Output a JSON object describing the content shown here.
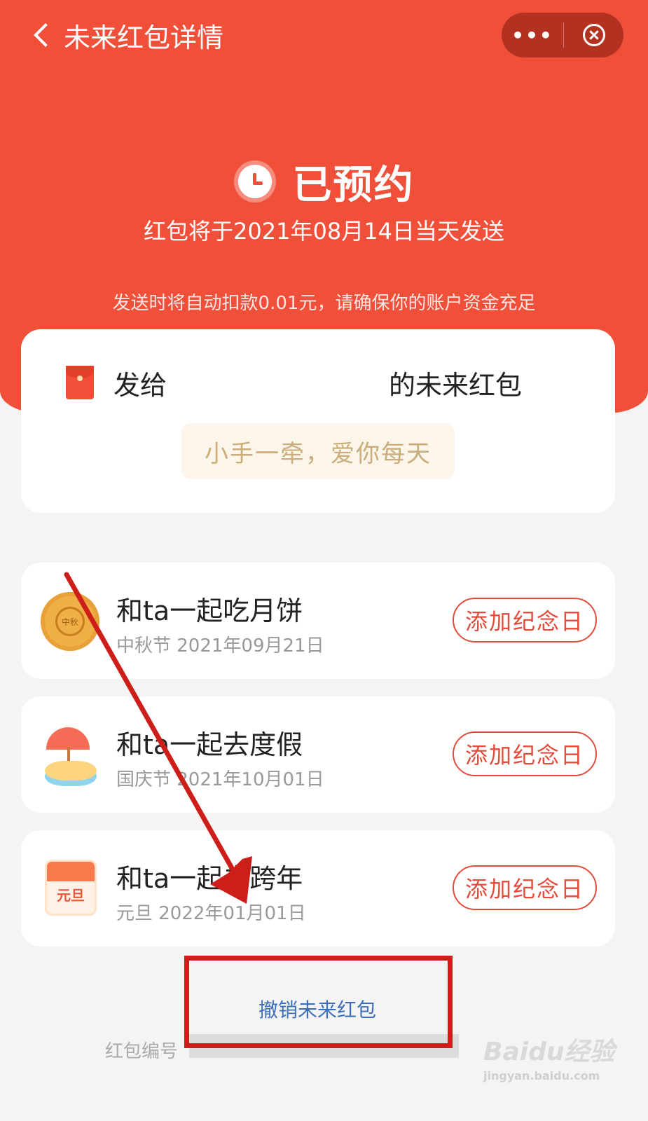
{
  "topbar": {
    "title": "未来红包详情",
    "more_label": "•••"
  },
  "status": {
    "label": "已预约",
    "send_date_text": "红包将于2021年08月14日当天发送",
    "deduct_note": "发送时将自动扣款0.01元，请确保你的账户资金充足"
  },
  "send_card": {
    "prefix": "发给",
    "suffix": "的未来红包",
    "blessing": "小手一牵，爱你每天"
  },
  "anniversaries": [
    {
      "title": "和ta一起吃月饼",
      "date": "中秋节 2021年09月21日",
      "button": "添加纪念日",
      "icon": "mooncake-icon",
      "icon_text": "中秋"
    },
    {
      "title": "和ta一起去度假",
      "date": "国庆节 2021年10月01日",
      "button": "添加纪念日",
      "icon": "beach-umbrella-icon"
    },
    {
      "title": "和ta一起去跨年",
      "date": "元旦 2022年01月01日",
      "button": "添加纪念日",
      "icon": "calendar-icon",
      "icon_text": "元旦"
    }
  ],
  "footer": {
    "cancel_label": "撤销未来红包",
    "redpacket_no_label": "红包编号"
  },
  "watermark": {
    "logo": "Baidu经验",
    "url": "jingyan.baidu.com"
  },
  "colors": {
    "brand_red": "#f0503a",
    "button_red": "#e24c3c",
    "link_blue": "#3d6fb8",
    "annotation_red": "#cc1f1a"
  }
}
